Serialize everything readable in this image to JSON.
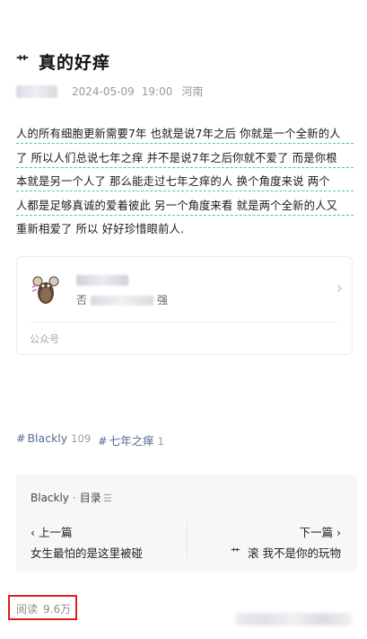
{
  "article": {
    "title_glyph": "艹",
    "title": "真的好痒",
    "date": "2024-05-09",
    "time": "19:00",
    "location": "河南",
    "lines": [
      "人的所有细胞更新需要7年  也就是说7年之后  你就是一个全新的人",
      "了  所以人们总说七年之痒  并不是说7年之后你就不爱了  而是你根",
      "本就是另一个人了  那么能走过七年之痒的人  换个角度来说  两个",
      "人都是足够真诚的爱着彼此  另一个角度来看  就是两个全新的人又",
      "重新相爱了  所以  好好珍惜眼前人."
    ]
  },
  "account_card": {
    "desc_prefix": "否",
    "desc_suffix": "强",
    "footer_label": "公众号",
    "chevron": "›"
  },
  "tags": [
    {
      "hash": "#",
      "label": "Blackly",
      "count": "109"
    },
    {
      "hash": "#",
      "label": "七年之痒",
      "count": "1"
    }
  ],
  "series_nav": {
    "series_name": "Blackly",
    "separator": "·",
    "catalog_label": "目录",
    "catalog_icon": "☰",
    "prev_label": "‹ 上一篇",
    "prev_title": "女生最怕的是这里被碰",
    "next_label": "下一篇 ›",
    "next_title_glyph": "艹",
    "next_title": "滚 我不是你的玩物"
  },
  "stats": {
    "read_label": "阅读",
    "read_count": "9.6万",
    "highlight_color": "#e11d1d"
  },
  "colors": {
    "link": "#576b95",
    "underline": "#58c1b2"
  }
}
